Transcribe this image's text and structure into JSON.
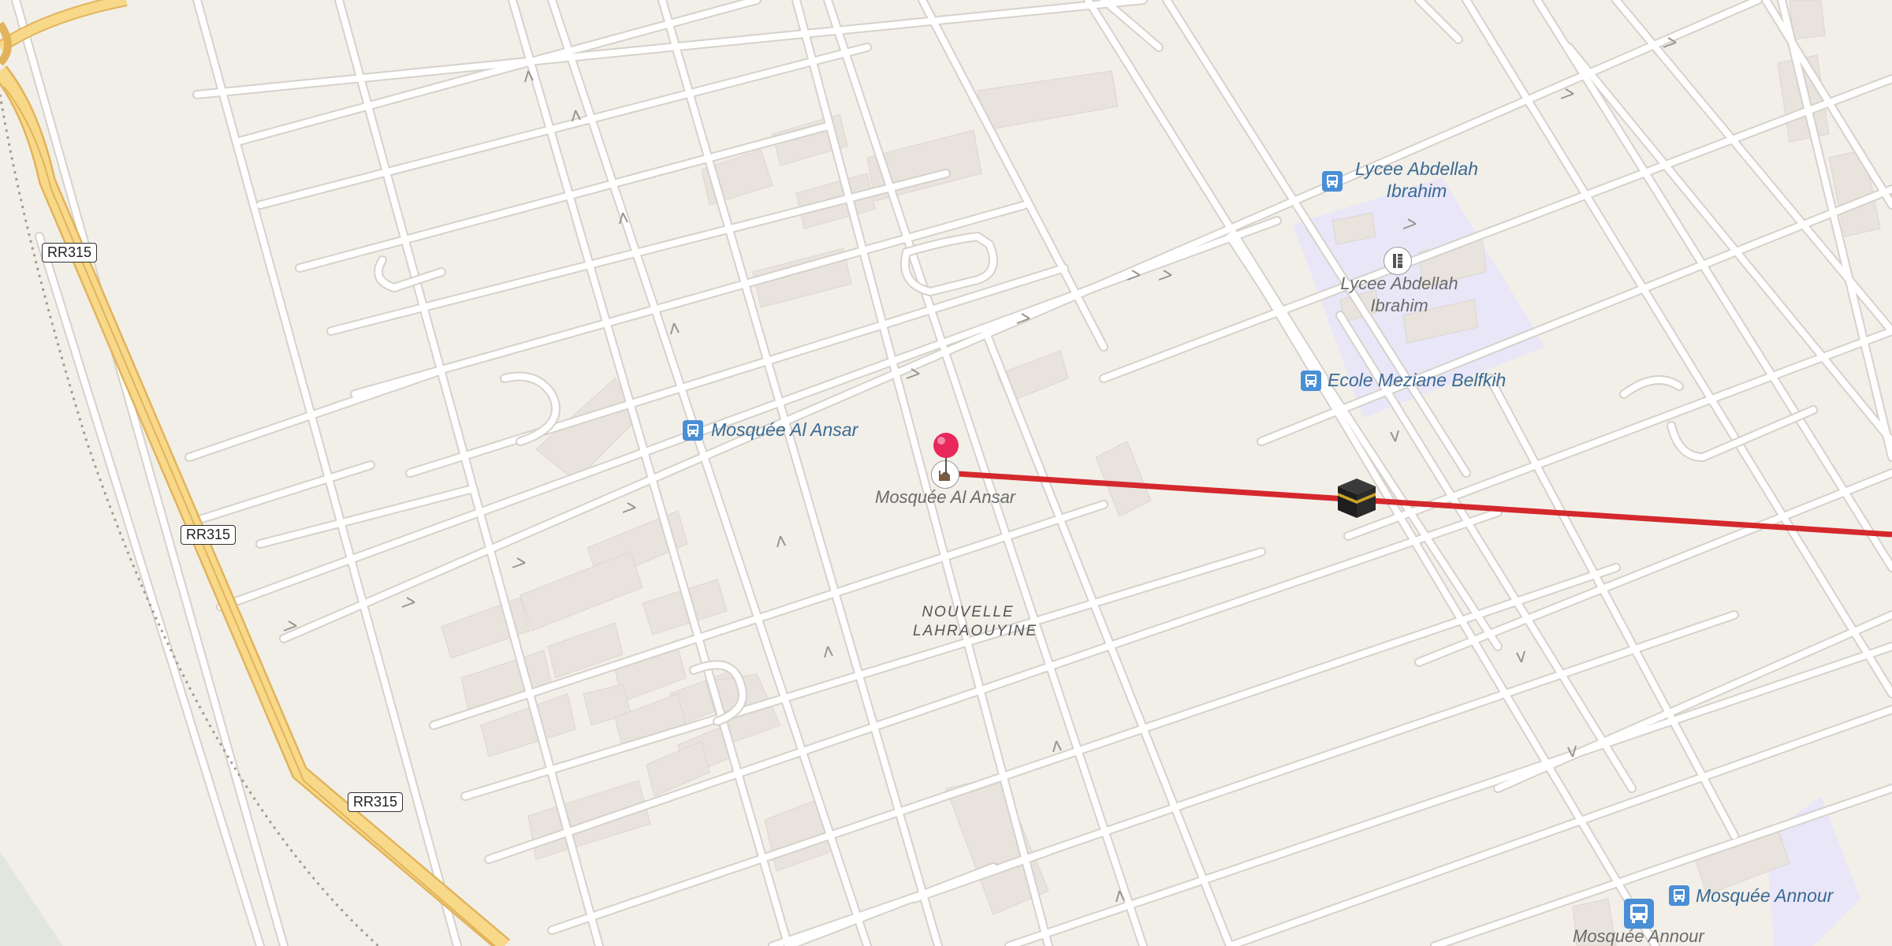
{
  "map": {
    "roads": [
      "RR315",
      "RR315",
      "RR315"
    ],
    "district": "NOUVELLE LAHRAOUYINE",
    "pois": {
      "mosque_bus": "Mosquée Al Ansar",
      "mosque": "Mosquée Al Ansar",
      "lycee_bus": "Lycee Abdellah Ibrahim",
      "lycee": "Lycee Abdellah Ibrahim",
      "ecole_bus": "Ecole Meziane Belfkih",
      "annour_bus": "Mosquée Annour",
      "annour": "Mosquée Annour"
    },
    "colors": {
      "background": "#f2efe9",
      "street": "#ffffff",
      "street_casing": "#d6d1ca",
      "highway": "#f8d98a",
      "highway_casing": "#e2b35a",
      "building": "#e8e3dc",
      "school_area": "#e9e6f8",
      "qibla_line": "#d4282c",
      "pin": "#e8275b",
      "bus_stop": "#4a8fd6"
    },
    "icons": [
      "bus-stop-icon",
      "mosque-icon",
      "school-icon",
      "location-pin-icon",
      "kaaba-icon",
      "oneway-arrow-icon"
    ]
  }
}
